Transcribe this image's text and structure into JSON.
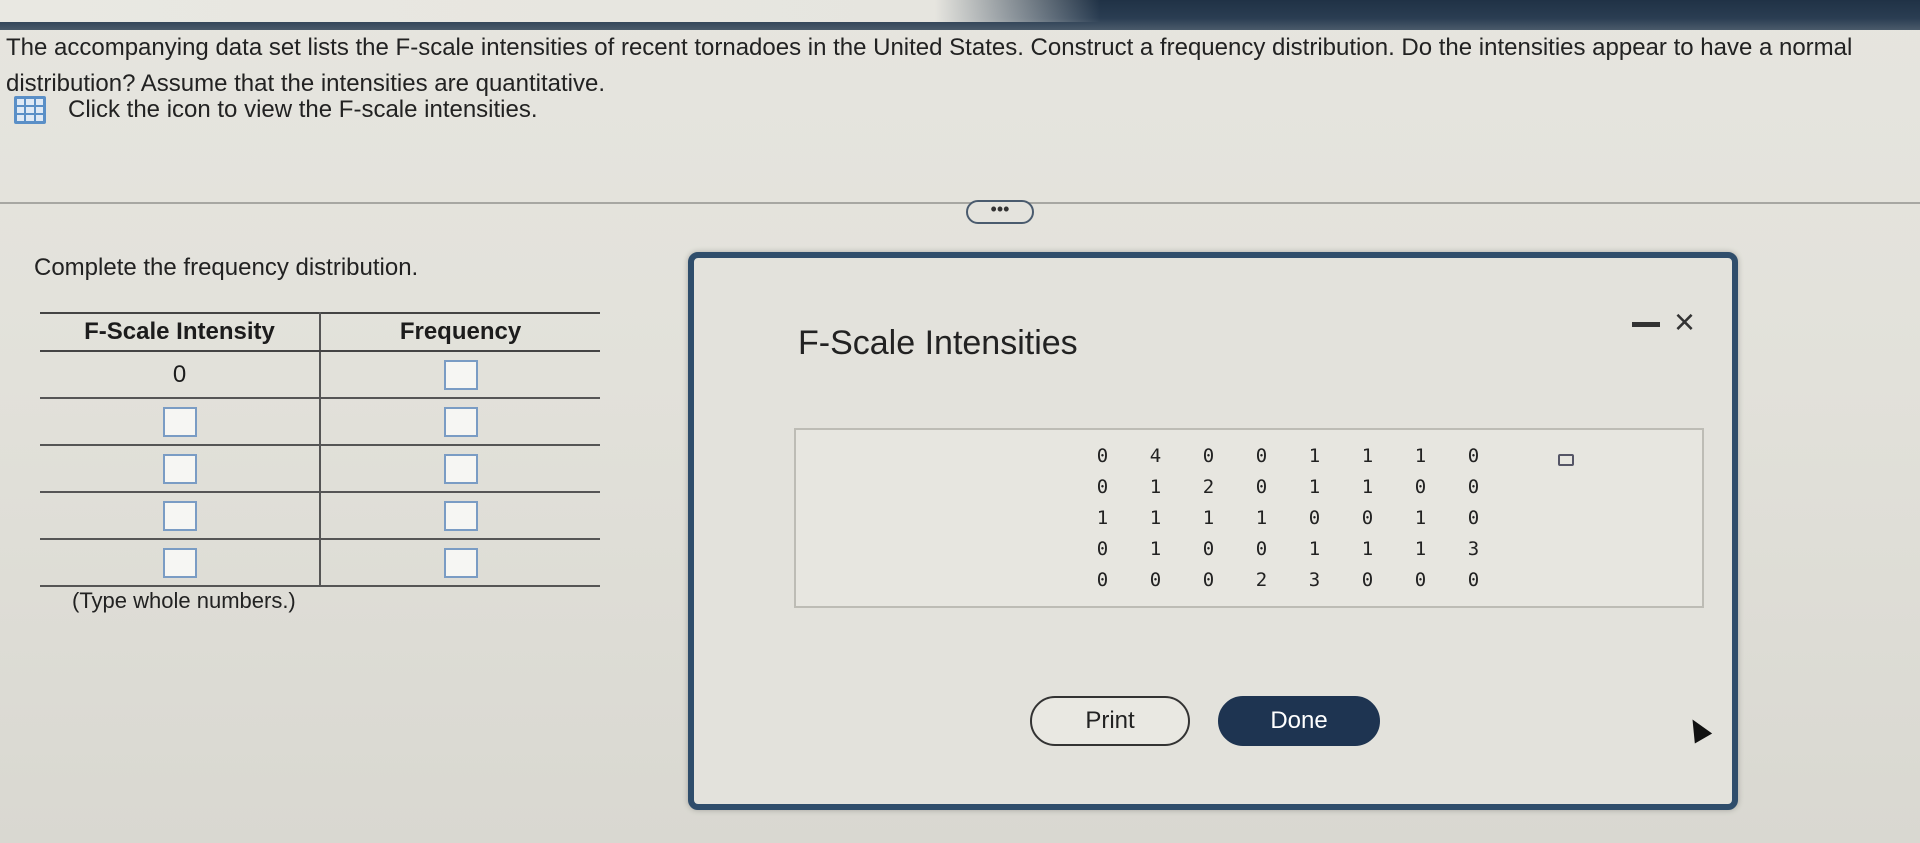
{
  "question": {
    "text": "The accompanying data set lists the F-scale intensities of recent tornadoes in the United States. Construct a frequency distribution. Do the intensities appear to have a normal distribution? Assume that the intensities are quantitative."
  },
  "hint": {
    "icon": "data-grid-icon",
    "text": "Click the icon to view the F-scale intensities."
  },
  "more_button": {
    "label": "•••"
  },
  "task": {
    "label": "Complete the frequency distribution.",
    "note": "(Type whole numbers.)"
  },
  "frequency_table": {
    "headers": [
      "F-Scale Intensity",
      "Frequency"
    ],
    "rows": [
      {
        "intensity": "0",
        "frequency": ""
      },
      {
        "intensity": "",
        "frequency": ""
      },
      {
        "intensity": "",
        "frequency": ""
      },
      {
        "intensity": "",
        "frequency": ""
      },
      {
        "intensity": "",
        "frequency": ""
      }
    ]
  },
  "dialog": {
    "title": "F-Scale Intensities",
    "minimize_icon": "minimize-icon",
    "close_icon": "close-icon",
    "close_label": "×",
    "data": [
      [
        "0",
        "4",
        "0",
        "0",
        "1",
        "1",
        "1",
        "0"
      ],
      [
        "0",
        "1",
        "2",
        "0",
        "1",
        "1",
        "0",
        "0"
      ],
      [
        "1",
        "1",
        "1",
        "1",
        "0",
        "0",
        "1",
        "0"
      ],
      [
        "0",
        "1",
        "0",
        "0",
        "1",
        "1",
        "1",
        "3"
      ],
      [
        "0",
        "0",
        "0",
        "2",
        "3",
        "0",
        "0",
        "0"
      ]
    ],
    "print_label": "Print",
    "done_label": "Done"
  },
  "colors": {
    "dialog_border": "#2f4d6b",
    "done_button": "#1e3451",
    "icon_blue": "#5a8fc7"
  }
}
